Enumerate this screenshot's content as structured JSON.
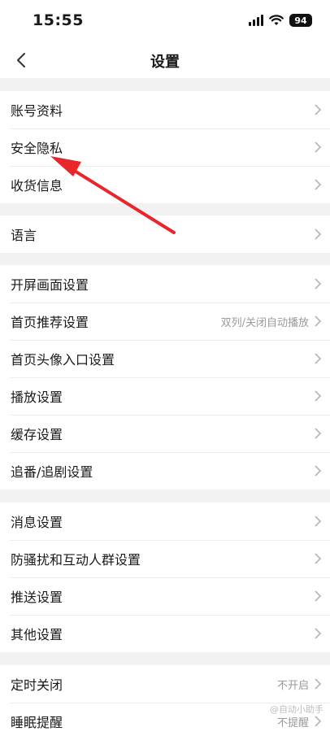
{
  "status_bar": {
    "time": "15:55",
    "battery": "94"
  },
  "header": {
    "title": "设置",
    "back_icon": "chevron-left-icon"
  },
  "groups": [
    {
      "items": [
        {
          "label": "账号资料"
        },
        {
          "label": "安全隐私"
        },
        {
          "label": "收货信息"
        }
      ]
    },
    {
      "items": [
        {
          "label": "语言"
        }
      ]
    },
    {
      "items": [
        {
          "label": "开屏画面设置"
        },
        {
          "label": "首页推荐设置",
          "value": "双列/关闭自动播放"
        },
        {
          "label": "首页头像入口设置"
        },
        {
          "label": "播放设置"
        },
        {
          "label": "缓存设置"
        },
        {
          "label": "追番/追剧设置"
        }
      ]
    },
    {
      "items": [
        {
          "label": "消息设置"
        },
        {
          "label": "防骚扰和互动人群设置"
        },
        {
          "label": "推送设置"
        },
        {
          "label": "其他设置"
        }
      ]
    },
    {
      "items": [
        {
          "label": "定时关闭",
          "value": "不开启"
        },
        {
          "label": "睡眠提醒",
          "value": "不提醒"
        }
      ]
    }
  ],
  "annotation": {
    "type": "red-arrow",
    "target": "安全隐私",
    "color": "#e8262b"
  },
  "watermark": "@自动小助手",
  "colors": {
    "background": "#f2f2f2",
    "row_bg": "#ffffff",
    "secondary_text": "#9a9a9a",
    "chevron": "#b5b5b5"
  }
}
